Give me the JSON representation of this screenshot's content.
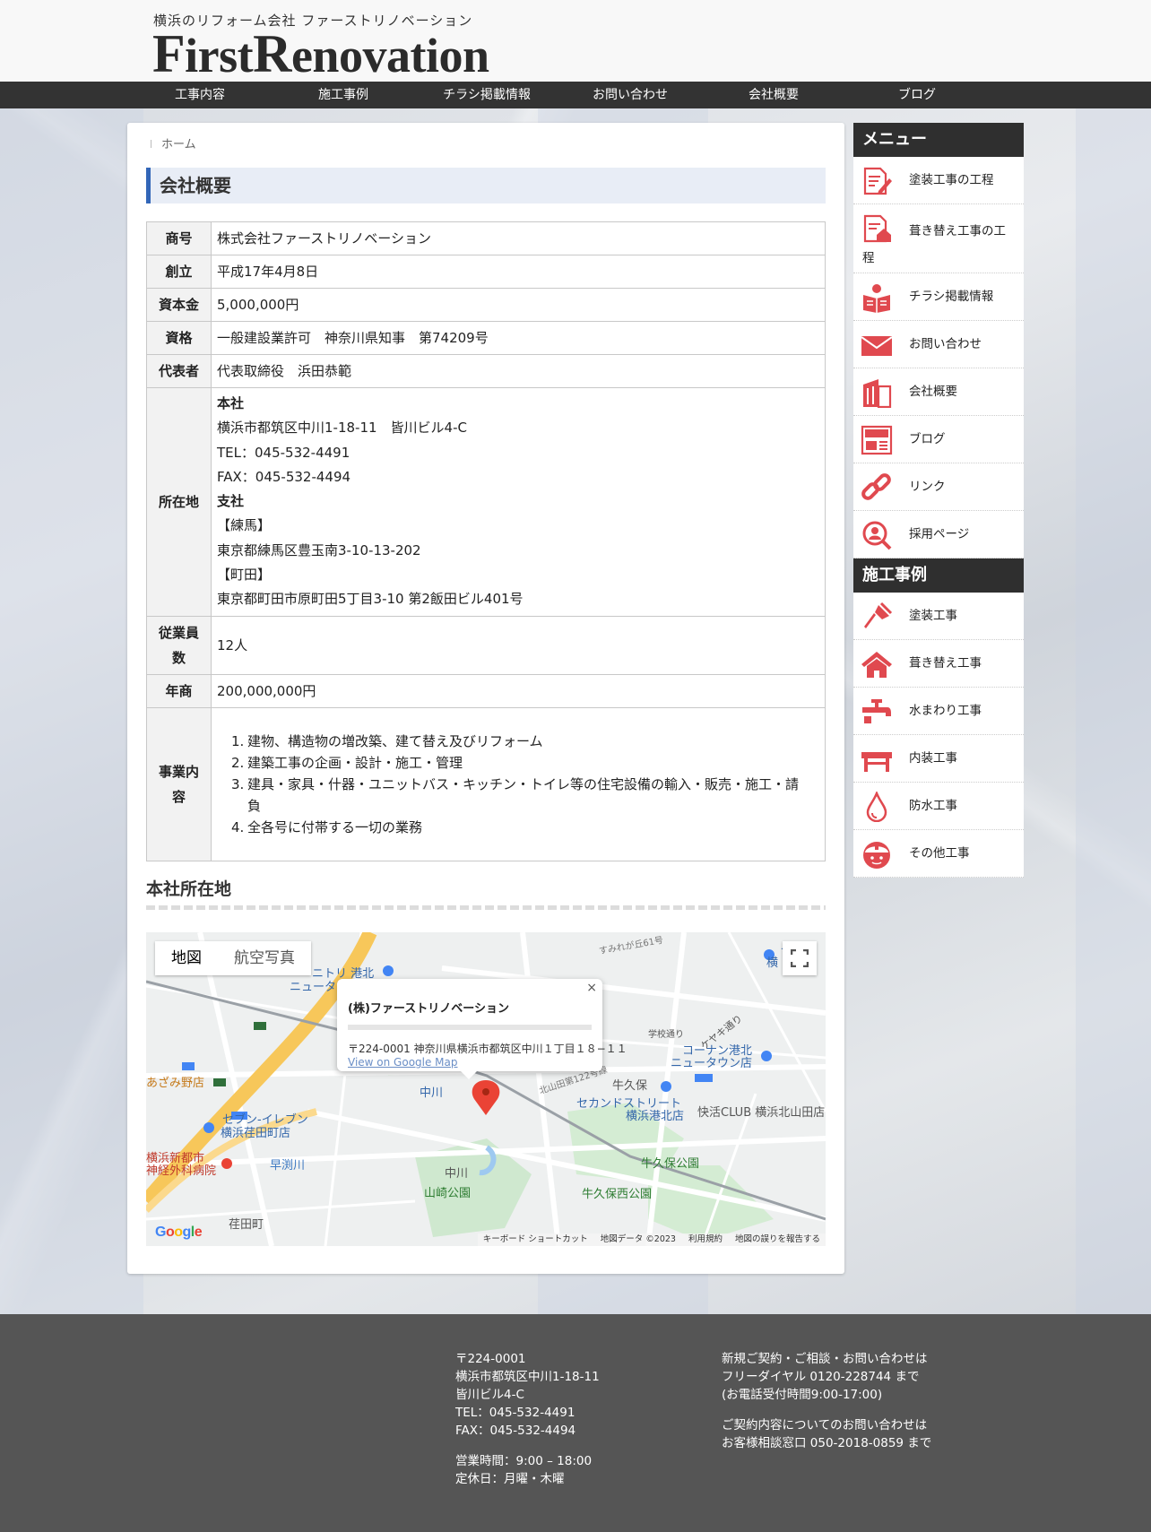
{
  "header": {
    "tagline": "横浜のリフォーム会社 ファーストリノベーション",
    "logo_first_initial": "F",
    "logo_first_rest": "irst",
    "logo_second_initial": "R",
    "logo_second_rest": "enovation"
  },
  "nav": {
    "items": [
      "工事内容",
      "施工事例",
      "チラシ掲載情報",
      "お問い合わせ",
      "会社概要",
      "ブログ"
    ]
  },
  "breadcrumb": {
    "home": "ホーム"
  },
  "page": {
    "title": "会社概要",
    "info": {
      "trade_name_label": "商号",
      "trade_name": "株式会社ファーストリノベーション",
      "founded_label": "創立",
      "founded": "平成17年4月8日",
      "capital_label": "資本金",
      "capital": "5,000,000円",
      "license_label": "資格",
      "license": "一般建設業許可　神奈川県知事　第74209号",
      "rep_label": "代表者",
      "rep": "代表取締役　浜田恭範",
      "address_label": "所在地",
      "address_lines": [
        "本社",
        "横浜市都筑区中川1-18-11　皆川ビル4-C",
        "TEL：045-532-4491",
        "FAX：045-532-4494",
        "支社",
        "【練馬】",
        "東京都練馬区豊玉南3-10-13-202",
        "【町田】",
        "東京都町田市原町田5丁目3-10 第2飯田ビル401号"
      ],
      "employees_label_1": "従業員",
      "employees_label_2": "数",
      "employees": "12人",
      "revenue_label": "年商",
      "revenue": "200,000,000円",
      "business_label_1": "事業内",
      "business_label_2": "容",
      "business_items": [
        "建物、構造物の増改築、建て替え及びリフォーム",
        "建築工事の企画・設計・施工・管理",
        "建具・家具・什器・ユニットバス・キッチン・トイレ等の住宅設備の輸入・販売・施工・請負",
        "全各号に付帯する一切の業務"
      ]
    },
    "map_section_title": "本社所在地"
  },
  "map": {
    "tab_map": "地図",
    "tab_satellite": "航空写真",
    "popup_title": "(株)ファーストリノベーション",
    "popup_address": "〒224-0001 神奈川県横浜市都筑区中川１丁目１８−１１",
    "popup_link": "View on Google Map",
    "popup_close": "×",
    "google_logo": "Google",
    "footer_links": [
      "キーボード ショートカット",
      "地図データ ©2023",
      "利用規約",
      "地図の誤りを報告する"
    ],
    "labels": {
      "a": "ニトリ 港北",
      "b": "ニュータ",
      "c": "あざみ野店",
      "d": "セブン-イレブン",
      "e": "横浜荏田町店",
      "f": "横浜新都市",
      "g": "神経外科病院",
      "h": "早渕川",
      "i": "荏田町",
      "j": "中川",
      "k": "中川",
      "l": "山崎公園",
      "m": "牛久保",
      "n": "セカンドストリート",
      "o": "横浜港北店",
      "p": "快活CLUB 横浜北山田店",
      "q": "牛久保公園",
      "r": "牛久保西公園",
      "s": "コーナン港北",
      "t": "ニュータウン店",
      "u": "ケヤキ通り",
      "v": "学校通り",
      "w": "すみれが丘61号",
      "x": "北山田第122号線",
      "y": "セ",
      "z": "横"
    }
  },
  "sidebar": {
    "menu_title": "メニュー",
    "menu_items": [
      "塗装工事の工程",
      "葺き替え工事の工程",
      "チラシ掲載情報",
      "お問い合わせ",
      "会社概要",
      "ブログ",
      "リンク",
      "採用ページ"
    ],
    "works_title": "施工事例",
    "works_items": [
      "塗装工事",
      "葺き替え工事",
      "水まわり工事",
      "内装工事",
      "防水工事",
      "その他工事"
    ],
    "accent_color": "#e0494f"
  },
  "footer": {
    "address_lines": [
      "〒224-0001",
      "横浜市都筑区中川1-18-11",
      "皆川ビル4-C",
      "TEL：045-532-4491",
      "FAX：045-532-4494"
    ],
    "hours_lines": [
      "営業時間：9:00 – 18:00",
      "定休日：月曜・木曜"
    ],
    "contact_lines": [
      "新規ご契約・ご相談・お問い合わせは",
      "フリーダイヤル 0120-228744 まで",
      "(お電話受付時間9:00-17:00)"
    ],
    "support_lines": [
      "ご契約内容についてのお問い合わせは",
      "お客様相談窓口 050-2018-0859 まで"
    ]
  }
}
